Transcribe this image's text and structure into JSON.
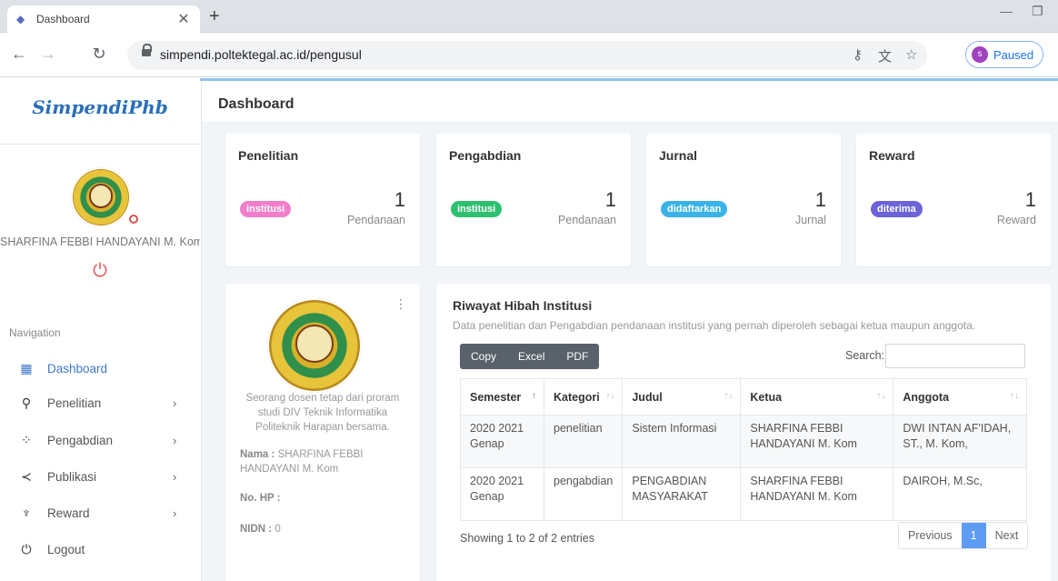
{
  "browser": {
    "tab_title": "Dashboard",
    "url": "simpendi.poltektegal.ac.id/pengusul",
    "profile_initial": "s",
    "profile_label": "Paused"
  },
  "sidebar": {
    "logo": "SimpendiPhb",
    "user_name": "SHARFINA FEBBI HANDAYANI M. Kom",
    "nav_heading": "Navigation",
    "items": [
      {
        "label": "Dashboard",
        "icon": "grid-icon",
        "active": true
      },
      {
        "label": "Penelitian",
        "icon": "search-icon"
      },
      {
        "label": "Pengabdian",
        "icon": "spinner-icon"
      },
      {
        "label": "Publikasi",
        "icon": "share-icon"
      },
      {
        "label": "Reward",
        "icon": "trophy-icon"
      },
      {
        "label": "Logout",
        "icon": "power-icon"
      }
    ]
  },
  "main": {
    "page_title": "Dashboard",
    "stats": [
      {
        "title": "Penelitian",
        "badge": "institusi",
        "badge_color": "#f27ecb",
        "value": "1",
        "unit": "Pendanaan"
      },
      {
        "title": "Pengabdian",
        "badge": "institusi",
        "badge_color": "#2fbf71",
        "value": "1",
        "unit": "Pendanaan"
      },
      {
        "title": "Jurnal",
        "badge": "didaftarkan",
        "badge_color": "#3ab3e8",
        "value": "1",
        "unit": "Jurnal"
      },
      {
        "title": "Reward",
        "badge": "diterima",
        "badge_color": "#6c63d9",
        "value": "1",
        "unit": "Reward"
      }
    ],
    "profile_card": {
      "description": "Seorang dosen tetap dari proram studi DIV Teknik Informatika Politeknik Harapan bersama.",
      "nama_label": "Nama :",
      "nama_value": "SHARFINA FEBBI HANDAYANI M. Kom",
      "hp_label": "No. HP :",
      "hp_value": "",
      "nidn_label": "NIDN :",
      "nidn_value": "0"
    },
    "hibah": {
      "title": "Riwayat Hibah Institusi",
      "subtitle": "Data penelitian dan Pengabdian pendanaan institusi yang pernah diperoleh sebagai ketua maupun anggota.",
      "buttons": [
        "Copy",
        "Excel",
        "PDF"
      ],
      "search_label": "Search:",
      "search_value": "",
      "columns": [
        "Semester",
        "Kategori",
        "Judul",
        "Ketua",
        "Anggota"
      ],
      "rows": [
        {
          "semester": "2020 2021 Genap",
          "kategori": "penelitian",
          "judul": "Sistem Informasi",
          "ketua": "SHARFINA FEBBI HANDAYANI M. Kom",
          "anggota": "DWI INTAN AF'IDAH, ST., M. Kom,"
        },
        {
          "semester": "2020 2021 Genap",
          "kategori": "pengabdian",
          "judul": "PENGABDIAN MASYARAKAT",
          "ketua": "SHARFINA FEBBI HANDAYANI M. Kom",
          "anggota": "DAIROH, M.Sc,"
        }
      ],
      "info": "Showing 1 to 2 of 2 entries",
      "pager": {
        "previous": "Previous",
        "current": "1",
        "next": "Next"
      }
    }
  }
}
